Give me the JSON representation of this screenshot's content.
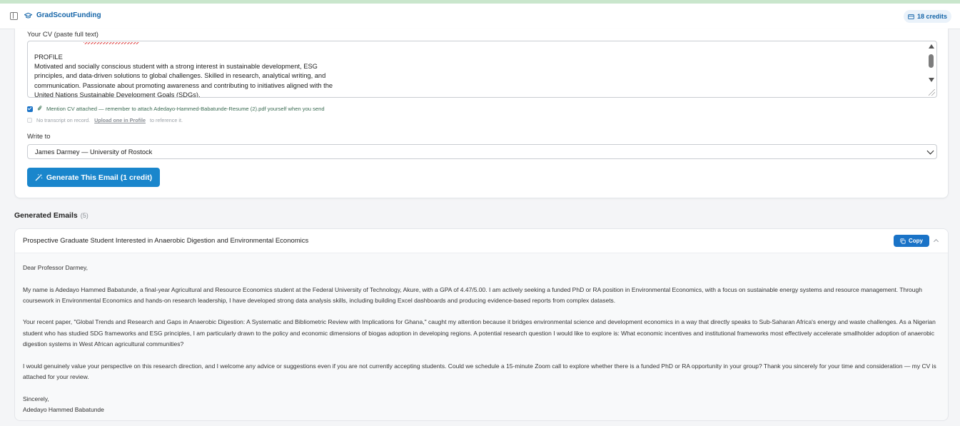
{
  "header": {
    "app_name": "GradScoutFunding",
    "credits_label": "18 credits"
  },
  "form": {
    "cv_label": "Your CV (paste full text)",
    "cv_text": "PROFILE\nMotivated and socially conscious student with a strong interest in sustainable development, ESG\nprinciples, and data-driven solutions to global challenges. Skilled in research, analytical writing, and\ncommunication. Passionate about promoting awareness and contributing to initiatives aligned with the\nUnited Nations Sustainable Development Goals (SDGs).",
    "mention_cv_label": "Mention CV attached — remember to attach Adedayo-Hammed-Babatunde-Resume (2).pdf yourself when you send",
    "mention_cv_checked": true,
    "no_transcript_text": "No transcript on record.",
    "upload_link": "Upload one in Profile",
    "reference_text": "to reference it.",
    "write_to_label": "Write to",
    "write_to_value": "James Darmey — University of Rostock",
    "generate_button": "Generate This Email (1 credit)"
  },
  "generated": {
    "heading": "Generated Emails",
    "count": "(5)",
    "email": {
      "subject": "Prospective Graduate Student Interested in Anaerobic Digestion and Environmental Economics",
      "copy_label": "Copy",
      "greeting": "Dear Professor Darmey,",
      "para1": "My name is Adedayo Hammed Babatunde, a final-year Agricultural and Resource Economics student at the Federal University of Technology, Akure, with a GPA of 4.47/5.00. I am actively seeking a funded PhD or RA position in Environmental Economics, with a focus on sustainable energy systems and resource management. Through coursework in Environmental Economics and hands-on research leadership, I have developed strong data analysis skills, including building Excel dashboards and producing evidence-based reports from complex datasets.",
      "para2": "Your recent paper, \"Global Trends and Research and Gaps in Anaerobic Digestion: A Systematic and Bibliometric Review with Implications for Ghana,\" caught my attention because it bridges environmental science and development economics in a way that directly speaks to Sub-Saharan Africa's energy and waste challenges. As a Nigerian student who has studied SDG frameworks and ESG principles, I am particularly drawn to the policy and economic dimensions of biogas adoption in developing regions. A potential research question I would like to explore is: What economic incentives and institutional frameworks most effectively accelerate smallholder adoption of anaerobic digestion systems in West African agricultural communities?",
      "para3": "I would genuinely value your perspective on this research direction, and I welcome any advice or suggestions even if you are not currently accepting students. Could we schedule a 15-minute Zoom call to explore whether there is a funded PhD or RA opportunity in your group? Thank you sincerely for your time and consideration — my CV is attached for your review.",
      "signoff": "Sincerely,",
      "signature": "Adedayo Hammed Babatunde"
    }
  },
  "colors": {
    "accent": "#1a86cc",
    "brand": "#1565a8"
  }
}
